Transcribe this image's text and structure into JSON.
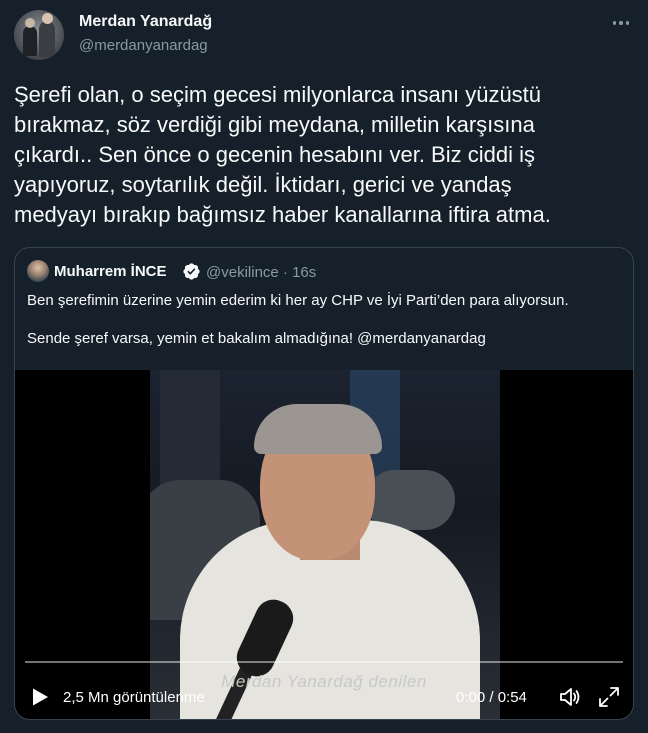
{
  "author": {
    "name": "Merdan Yanardağ",
    "handle": "@merdanyanardag"
  },
  "tweet": {
    "text": "Şerefi olan, o seçim gecesi milyonlarca insanı yüzüstü\nbırakmaz, söz verdiği gibi meydana, milletin karşısına\nçıkardı.. Sen önce o gecenin hesabını ver. Biz ciddi iş\nyapıyoruz, soytarılık değil. İktidarı, gerici ve yandaş\nmedyayı bırakıp bağımsız haber kanallarına iftira atma."
  },
  "quote": {
    "name": "Muharrem İNCE",
    "handle_time": "@vekilince · 16s",
    "line1": "Ben şerefimin üzerine yemin ederim ki her ay CHP ve İyi Parti’den para alıyorsun.",
    "line2_text": "Sende şeref varsa, yemin et bakalım almadığına! ",
    "line2_mention": "@merdanyanardag"
  },
  "video": {
    "subtitle": "Merdan Yanardağ denilen",
    "views": "2,5 Mn görüntülenme",
    "time": "0:00 / 0:54",
    "progress": 0
  },
  "icons": {
    "more": "more-horizontal-icon",
    "verified": "verified-badge-icon",
    "play": "play-icon",
    "volume": "volume-icon",
    "fullscreen": "fullscreen-icon"
  },
  "colors": {
    "background": "#15202b",
    "text": "#f7f9f9",
    "secondary": "#8b98a5",
    "border": "#38444d",
    "verified": "#1d9bf0"
  }
}
